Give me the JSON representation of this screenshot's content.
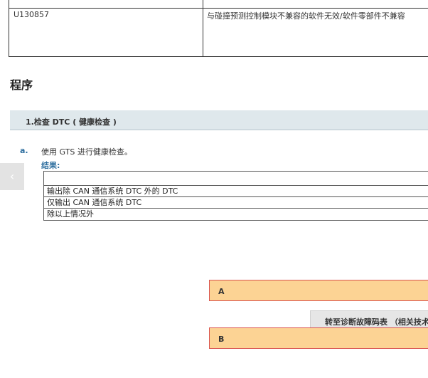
{
  "top_table": {
    "code": "U130857",
    "description": "与碰撞预测控制模块不兼容的软件无效/软件零部件不兼容"
  },
  "heading": "程序",
  "step": {
    "title": "1.检查 DTC ( 健康检查 )"
  },
  "instruction": {
    "bullet": "a.",
    "text": "使用 GTS 进行健康检查。",
    "result_label": "结果:"
  },
  "result_rows": [
    "",
    "输出除 CAN 通信系统 DTC 外的 DTC",
    "仅输出 CAN 通信系统 DTC",
    "除以上情况外"
  ],
  "side_arrow": "‹",
  "option_a": "A",
  "goto_button": "转至诊断故障码表 （相关技术",
  "option_b": "B"
}
